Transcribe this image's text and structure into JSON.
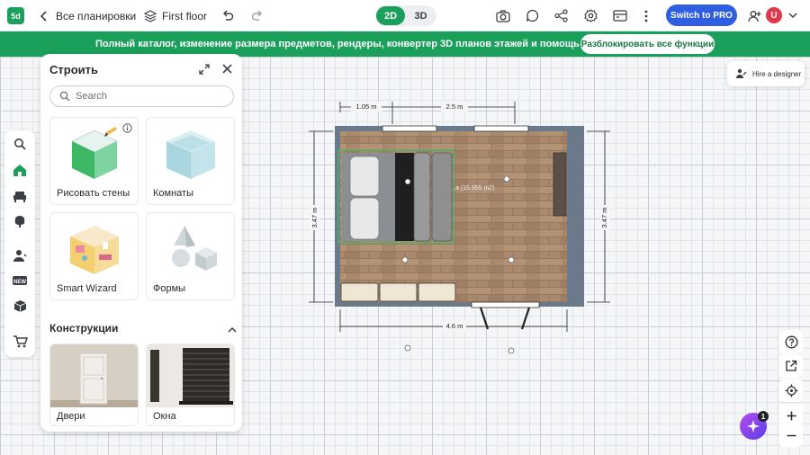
{
  "topbar": {
    "logo": "5d",
    "back_label": "Все планировки",
    "floor_label": "First floor",
    "view_2d": "2D",
    "view_3d": "3D",
    "pro_button": "Switch to PRO",
    "avatar_initial": "U",
    "icons": [
      "back-icon",
      "layers-icon",
      "undo-icon",
      "redo-icon",
      "camera-icon",
      "chat-icon",
      "share-icon",
      "settings-icon",
      "ticket-icon",
      "more-icon",
      "add-user-icon",
      "chevron-down-icon"
    ]
  },
  "banner": {
    "text": "Полный каталог, изменение размера предметов, рендеры, конвертер 3D планов этажей и помощь ИИ",
    "button": "Разблокировать все функции",
    "color": "#1aa05b"
  },
  "sidebar": {
    "icons": [
      "search-icon",
      "home-icon",
      "sofa-icon",
      "tree-icon",
      "person-icon",
      "new-badge-icon",
      "box-icon",
      "cart-icon"
    ],
    "active": "home-icon"
  },
  "panel": {
    "title": "Строить",
    "search_placeholder": "Search",
    "cards": [
      {
        "label": "Рисовать стены"
      },
      {
        "label": "Комнаты"
      },
      {
        "label": "Smart Wizard"
      },
      {
        "label": "Формы"
      }
    ],
    "section_title": "Конструкции",
    "constructions": [
      {
        "label": "Двери"
      },
      {
        "label": "Окна"
      }
    ]
  },
  "floorplan": {
    "dim_top_left": "1.05 m",
    "dim_top_right": "2.5 m",
    "dim_left": "3.47 m",
    "dim_right": "3.47 m",
    "dim_bottom": "4.6 m",
    "selection_area": "а (15.955 m2)"
  },
  "right_tools": {
    "hire": "Hire a designer",
    "icons": [
      "help-icon",
      "open-external-icon",
      "locate-icon",
      "zoom-in-icon",
      "zoom-out-icon"
    ],
    "ai_badge": "1"
  },
  "colors": {
    "accent_green": "#1aa05b",
    "pro_blue": "#2f5fe0",
    "avatar_red": "#e0384a"
  }
}
